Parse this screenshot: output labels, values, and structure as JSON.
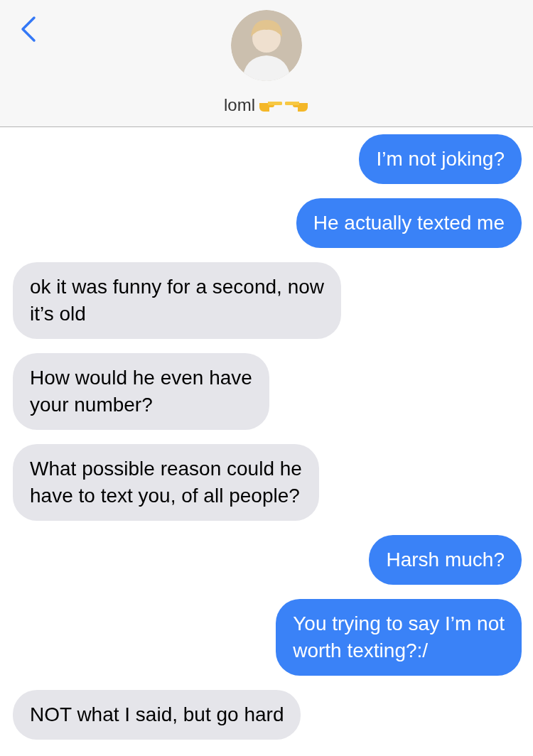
{
  "header": {
    "contact_name": "loml"
  },
  "messages": [
    {
      "kind": "sent",
      "lines": [
        "I’m not joking?"
      ]
    },
    {
      "kind": "sent",
      "lines": [
        "He actually texted me"
      ]
    },
    {
      "kind": "received",
      "lines": [
        "ok it was funny for a second, now",
        "it’s old"
      ]
    },
    {
      "kind": "received",
      "lines": [
        "How would he even have",
        "your number?"
      ]
    },
    {
      "kind": "received",
      "lines": [
        "What possible reason could he",
        "have to text you, of all people?"
      ]
    },
    {
      "kind": "sent",
      "lines": [
        "Harsh much?"
      ]
    },
    {
      "kind": "sent",
      "lines": [
        "You trying to say I’m not",
        "worth texting?:/"
      ]
    },
    {
      "kind": "received",
      "lines": [
        "NOT what I said, but go hard"
      ]
    }
  ]
}
